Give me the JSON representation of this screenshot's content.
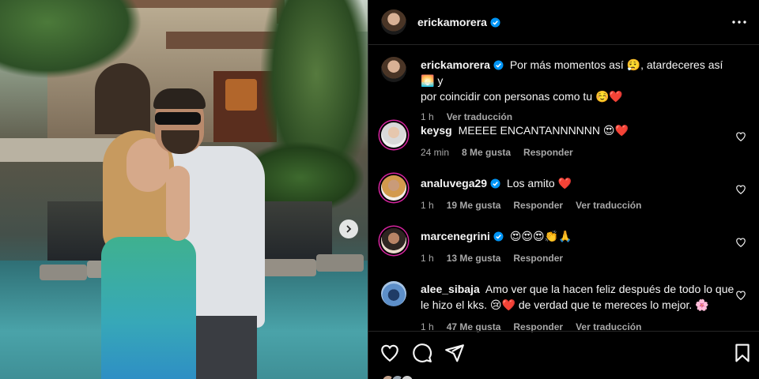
{
  "post": {
    "author": "erickamorera",
    "caption_user": "erickamorera",
    "caption_line1": "Por más momentos así 😮‍💨, atardeceres así 🌅 y",
    "caption_line2": "por coincidir con personas como tu ☺️❤️",
    "caption_time": "1 h",
    "caption_translate": "Ver traducción"
  },
  "comments": [
    {
      "user": "keysg",
      "verified": false,
      "text": "MEEEE ENCANTANNNNNN 😍❤️",
      "time": "24 min",
      "likes": "8 Me gusta",
      "reply": "Responder",
      "translate": ""
    },
    {
      "user": "analuvega29",
      "verified": true,
      "text": "Los amito ❤️",
      "time": "1 h",
      "likes": "19 Me gusta",
      "reply": "Responder",
      "translate": "Ver traducción"
    },
    {
      "user": "marcenegrini",
      "verified": true,
      "text": "😍😍😍👏🙏",
      "time": "1 h",
      "likes": "13 Me gusta",
      "reply": "Responder",
      "translate": ""
    },
    {
      "user": "alee_sibaja",
      "verified": false,
      "text_line1": "Amo ver que la hacen feliz después de todo lo que",
      "text_line2": "le hizo el kks. 😢❤️ de verdad que te mereces lo mejor. 🌸",
      "time": "1 h",
      "likes": "47 Me gusta",
      "reply": "Responder",
      "translate": "Ver traducción"
    }
  ],
  "icons": {
    "more": "more-options-icon",
    "next": "chevron-right-icon",
    "like": "heart-icon",
    "comment": "comment-icon",
    "share": "share-icon",
    "save": "bookmark-icon",
    "verified": "verified-badge-icon"
  },
  "colors": {
    "background": "#000000",
    "text": "#f5f5f5",
    "secondary": "#a8a8a8",
    "verified": "#0095f6",
    "divider": "#262626"
  }
}
